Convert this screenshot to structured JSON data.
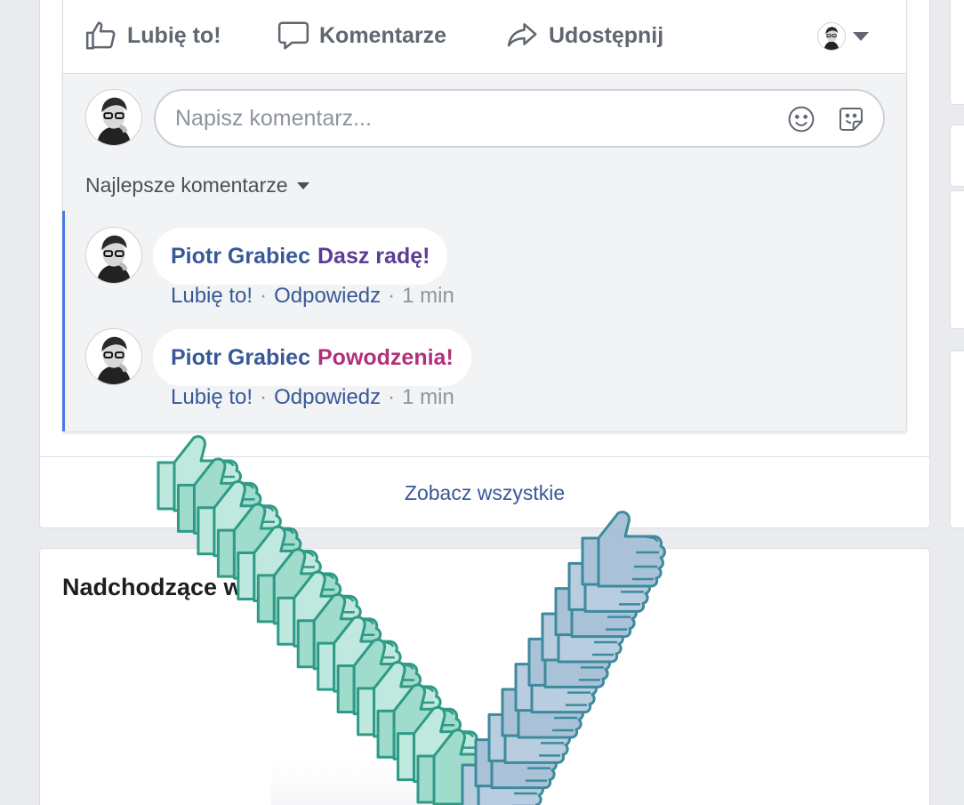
{
  "post_actions": {
    "like_label": "Lubię to!",
    "comment_label": "Komentarze",
    "share_label": "Udostępnij"
  },
  "comment_box": {
    "placeholder": "Napisz komentarz..."
  },
  "comments_sort": {
    "label": "Najlepsze komentarze"
  },
  "comments": [
    {
      "author": "Piotr Grabiec",
      "text": "Dasz radę!",
      "text_color": "#5b3d95",
      "like_label": "Lubię to!",
      "reply_label": "Odpowiedz",
      "time": "1 min"
    },
    {
      "author": "Piotr Grabiec",
      "text": "Powodzenia!",
      "text_color": "#b0307a",
      "like_label": "Lubię to!",
      "reply_label": "Odpowiedz",
      "time": "1 min"
    }
  ],
  "see_all": {
    "label": "Zobacz wszystkie"
  },
  "events_section": {
    "title": "Nadchodzące wydar"
  },
  "theme": {
    "link_color": "#385898",
    "accent_stripe": "#4a76e8",
    "thumb_green": "#2f9a86",
    "thumb_blue": "#3e8a9d"
  },
  "icons": {
    "like": "thumbs-up-icon",
    "comment": "speech-bubble-icon",
    "share": "share-arrow-icon",
    "emoji": "smiley-icon",
    "sticker": "sticker-icon",
    "overlay": "thumbs-up-icon"
  }
}
